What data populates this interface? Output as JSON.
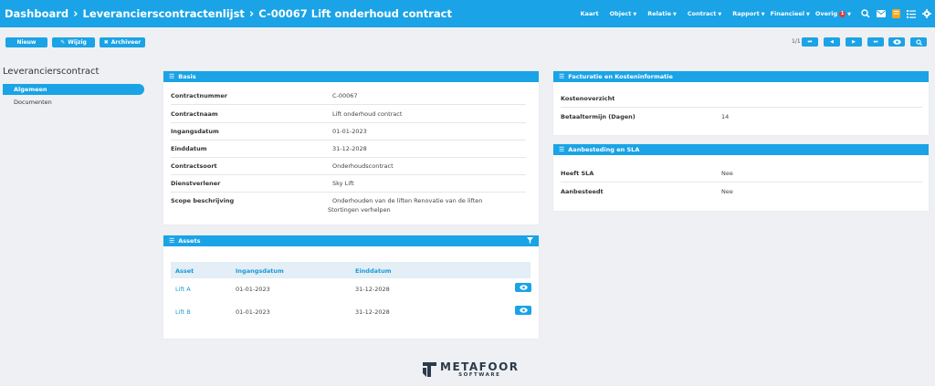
{
  "header": {
    "breadcrumbs": [
      "Dashboard",
      "Leverancierscontractenlijst",
      "C-00067 Lift onderhoud contract"
    ],
    "nav": [
      "Kaart",
      "Object",
      "Relatie",
      "Contract",
      "Rapport",
      "Financieel",
      "Overig"
    ],
    "notification_count": "1"
  },
  "toolbar": {
    "new_label": "Nieuw",
    "edit_label": "Wijzig",
    "archive_label": "Archiveer",
    "pager_text": "1/1"
  },
  "sidebar": {
    "title": "Leverancierscontract",
    "items": [
      {
        "label": "Algemeen",
        "active": true
      },
      {
        "label": "Documenten",
        "active": false
      }
    ]
  },
  "basis": {
    "title": "Basis",
    "rows": [
      {
        "label": "Contractnummer",
        "value": "C-00067"
      },
      {
        "label": "Contractnaam",
        "value": "Lift onderhoud contract"
      },
      {
        "label": "Ingangsdatum",
        "value": "01-01-2023"
      },
      {
        "label": "Einddatum",
        "value": "31-12-2028"
      },
      {
        "label": "Contractsoort",
        "value": "Onderhoudscontract"
      },
      {
        "label": "Dienstverlener",
        "value": "Sky Lift"
      },
      {
        "label": "Scope beschrijving",
        "value_line1": "Onderhouden van de liften Renovatie van de liften",
        "value_line2": "Stortingen verhelpen"
      }
    ]
  },
  "assets": {
    "title": "Assets",
    "columns": [
      "Asset",
      "Ingangsdatum",
      "Einddatum"
    ],
    "rows": [
      {
        "asset": "Lift A",
        "start": "01-01-2023",
        "end": "31-12-2028"
      },
      {
        "asset": "Lift B",
        "start": "01-01-2023",
        "end": "31-12-2028"
      }
    ]
  },
  "facturatie": {
    "title": "Facturatie en Kosteninformatie",
    "rows": [
      {
        "label": "Kostenoverzicht",
        "value": ""
      },
      {
        "label": "Betaaltermijn (Dagen)",
        "value": "14"
      }
    ]
  },
  "aanbesteding": {
    "title": "Aanbesteding en SLA",
    "rows": [
      {
        "label": "Heeft SLA",
        "value": "Nee"
      },
      {
        "label": "Aanbesteedt",
        "value": "Nee"
      }
    ]
  },
  "footer": {
    "logo_main": "METAFOOR",
    "logo_sub": "SOFTWARE"
  },
  "colors": {
    "accent": "#1aa3e6",
    "background": "#eef0f3",
    "badge": "#e53935"
  }
}
